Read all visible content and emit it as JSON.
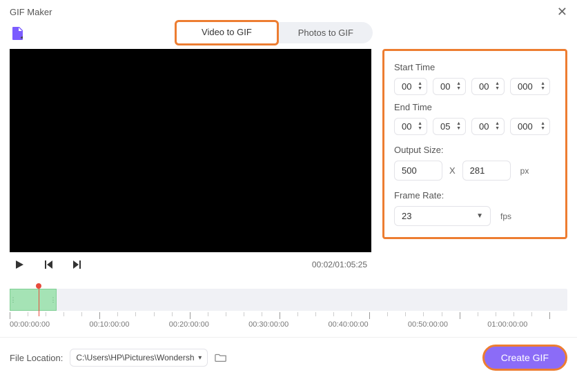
{
  "window": {
    "title": "GIF Maker"
  },
  "tabs": {
    "video": "Video to GIF",
    "photos": "Photos to GIF"
  },
  "playback": {
    "time_display": "00:02/01:05:25"
  },
  "settings": {
    "start_label": "Start Time",
    "start": {
      "h": "00",
      "m": "00",
      "s": "00",
      "ms": "000"
    },
    "end_label": "End Time",
    "end": {
      "h": "00",
      "m": "05",
      "s": "00",
      "ms": "000"
    },
    "output_size_label": "Output Size:",
    "output_w": "500",
    "output_h": "281",
    "px_unit": "px",
    "x_sep": "X",
    "frame_rate_label": "Frame Rate:",
    "frame_rate": "23",
    "fps_unit": "fps"
  },
  "timeline": {
    "marks": [
      "00:00:00:00",
      "00:10:00:00",
      "00:20:00:00",
      "00:30:00:00",
      "00:40:00:00",
      "00:50:00:00",
      "01:00:00:00"
    ]
  },
  "bottom": {
    "file_location_label": "File Location:",
    "file_location_value": "C:\\Users\\HP\\Pictures\\Wondersh",
    "create_label": "Create GIF"
  }
}
